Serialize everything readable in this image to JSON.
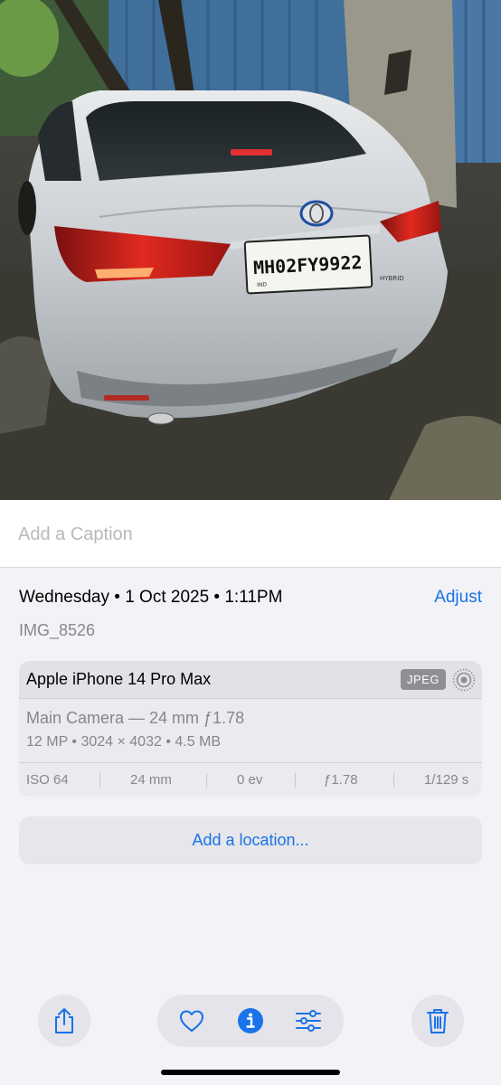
{
  "photo": {
    "plate_text": "MH02FY9922",
    "plate_prefix": "IND",
    "badge": "HYBRID"
  },
  "caption": {
    "placeholder": "Add a Caption"
  },
  "info": {
    "date_time": "Wednesday • 1 Oct 2025 • 1:11PM",
    "adjust_label": "Adjust",
    "filename": "IMG_8526"
  },
  "device": {
    "name": "Apple iPhone 14 Pro Max",
    "format": "JPEG",
    "lens": "Main Camera — 24 mm ƒ1.78",
    "specs": "12 MP • 3024 × 4032 • 4.5 MB"
  },
  "exif": {
    "iso": "ISO 64",
    "focal": "24 mm",
    "ev": "0 ev",
    "aperture": "ƒ1.78",
    "shutter": "1/129 s"
  },
  "location": {
    "label": "Add a location..."
  },
  "toolbar": {
    "share_icon": "share-icon",
    "favorite_icon": "heart-icon",
    "info_icon": "info-icon",
    "edit_icon": "sliders-icon",
    "delete_icon": "trash-icon"
  },
  "colors": {
    "accent": "#1a73e8",
    "secondary_text": "#86868b",
    "background": "#f2f2f7"
  }
}
